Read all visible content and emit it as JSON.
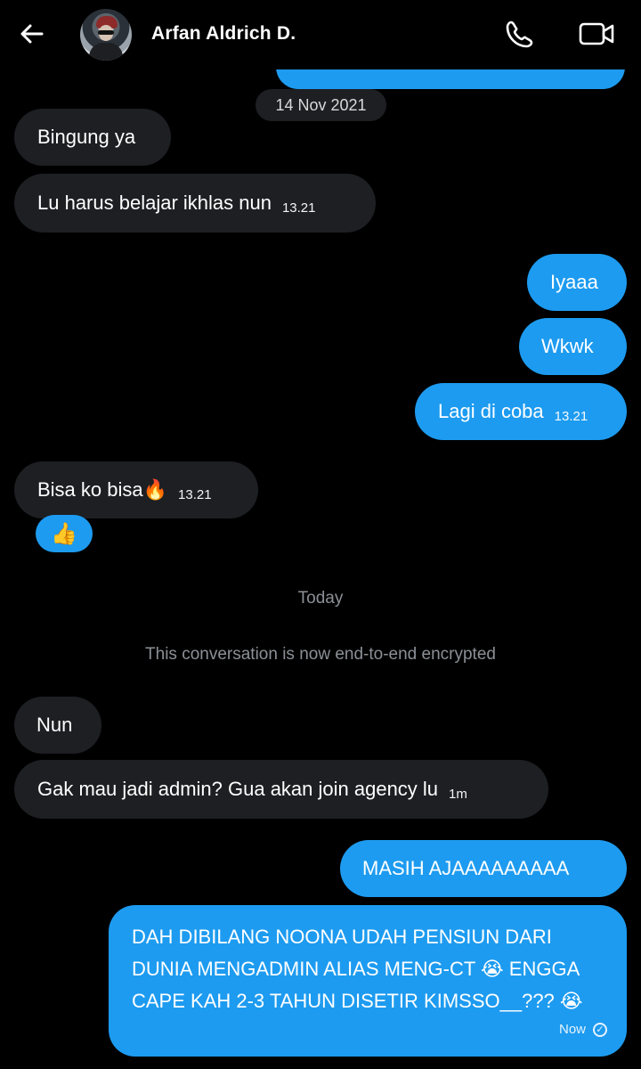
{
  "header": {
    "contact_name": "Arfan Aldrich D.",
    "icons": [
      "back-arrow-icon",
      "phone-icon",
      "video-camera-icon"
    ]
  },
  "colors": {
    "sent_bubble": "#1d9bf0",
    "received_bubble": "#1d1f23",
    "background": "#000000",
    "muted_text": "#8b9096"
  },
  "dates": {
    "first": "14 Nov 2021",
    "today": "Today"
  },
  "system": {
    "encrypted_notice": "This conversation is now end-to-end encrypted"
  },
  "messages": [
    {
      "direction": "received",
      "text": "Bingung ya",
      "time": ""
    },
    {
      "direction": "received",
      "text": "Lu harus belajar ikhlas nun",
      "time": "13.21"
    },
    {
      "direction": "sent",
      "text": "Iyaaa",
      "time": ""
    },
    {
      "direction": "sent",
      "text": "Wkwk",
      "time": ""
    },
    {
      "direction": "sent",
      "text": "Lagi di coba",
      "time": "13.21"
    },
    {
      "direction": "received",
      "text": "Bisa ko bisa🔥",
      "time": "13.21",
      "reaction": "👍"
    },
    {
      "direction": "received",
      "text": "Nun",
      "time": ""
    },
    {
      "direction": "received",
      "text": "Gak mau jadi admin? Gua akan join agency lu",
      "time": "1m"
    },
    {
      "direction": "sent",
      "text": "MASIH AJAAAAAAAAA",
      "time": ""
    },
    {
      "direction": "sent",
      "text": "DAH DIBILANG NOONA UDAH PENSIUN DARI DUNIA MENGADMIN ALIAS MENG-CT 😭 ENGGA CAPE KAH 2-3 TAHUN DISETIR KIMSSO__??? 😭",
      "time": "Now",
      "status": "read"
    }
  ]
}
